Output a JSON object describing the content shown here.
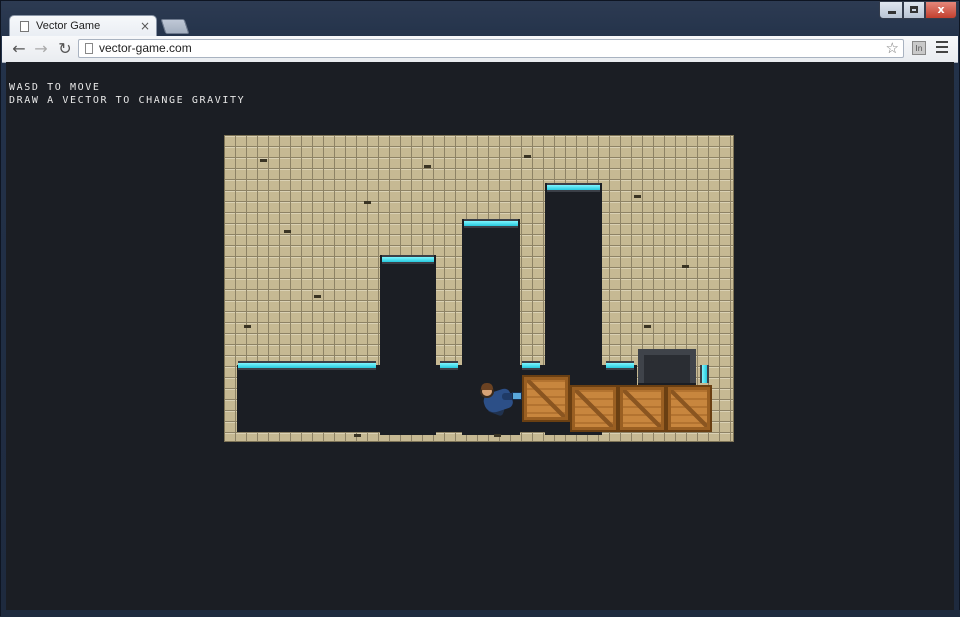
{
  "browser": {
    "tab_title": "Vector Game",
    "tab_close": "×",
    "url": "vector-game.com",
    "window_close": "x",
    "extension_label": "In"
  },
  "game": {
    "instructions": [
      "WASD TO MOVE",
      "DRAW A VECTOR TO CHANGE GRAVITY"
    ],
    "colors": {
      "background": "#1b1e24",
      "wall_tile": "#c6b993",
      "gravity_pad": "#27c9dd",
      "crate": "#c8863e"
    },
    "objects": {
      "crates": 4,
      "gravity_pads": 7,
      "player": "astronaut"
    }
  }
}
